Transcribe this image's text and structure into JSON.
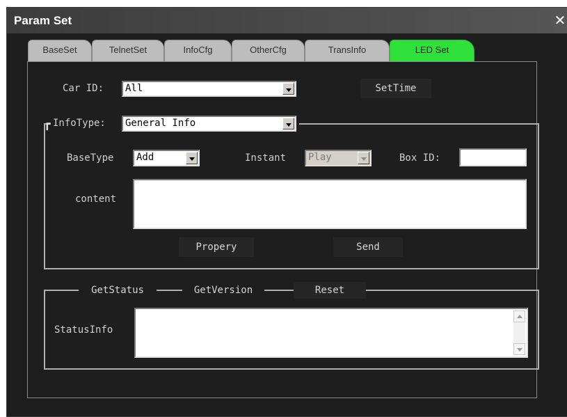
{
  "window": {
    "title": "Param Set",
    "close_symbol": "✕"
  },
  "tabs": [
    {
      "label": "BaseSet"
    },
    {
      "label": "TelnetSet"
    },
    {
      "label": "InfoCfg"
    },
    {
      "label": "OtherCfg"
    },
    {
      "label": "TransInfo"
    },
    {
      "label": "LED Set",
      "active": true
    }
  ],
  "car_id": {
    "label": "Car ID:",
    "value": "All"
  },
  "set_time_button": "SetTime",
  "info_type": {
    "label": "InfoType:",
    "value": "General Info"
  },
  "base_type": {
    "label": "BaseType",
    "value": "Add"
  },
  "instant": {
    "label": "Instant",
    "value": "Play"
  },
  "box_id": {
    "label": "Box ID:",
    "value": ""
  },
  "content": {
    "label": "content",
    "value": ""
  },
  "propery_button": "Propery",
  "send_button": "Send",
  "status_group": {
    "get_status_button": "GetStatus",
    "get_version_button": "GetVersion",
    "reset_button": "Reset",
    "status_info_label": "StatusInfo",
    "status_info_value": ""
  },
  "colors": {
    "active_tab": "#2fe03a",
    "background": "#1e1e1e",
    "tab": "#bdbdbd"
  }
}
